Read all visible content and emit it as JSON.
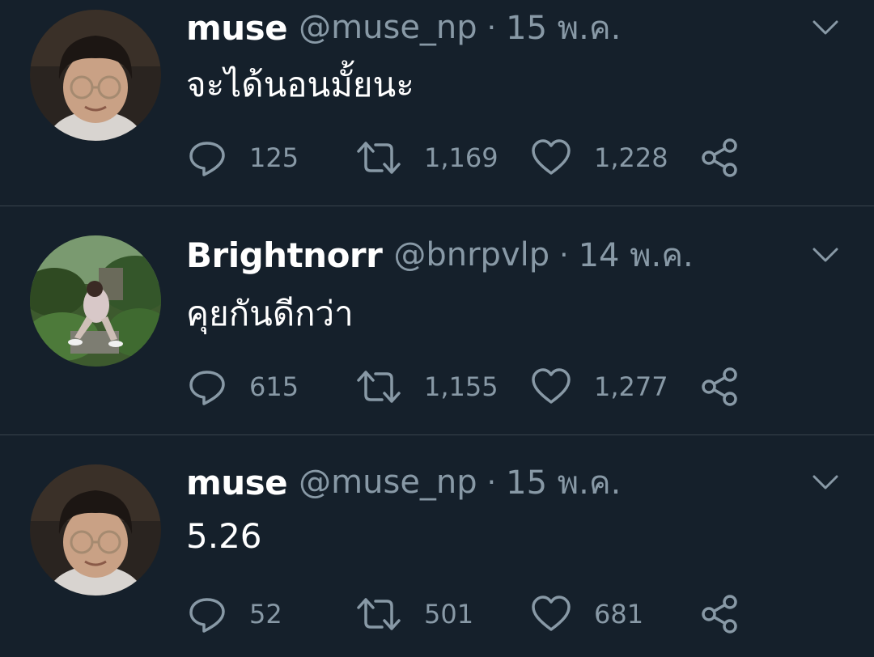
{
  "tweets": [
    {
      "name": "muse",
      "handle": "@muse_np",
      "separator": "·",
      "date": "15 พ.ค.",
      "text": "จะได้นอนมั้ยนะ",
      "replies": "125",
      "retweets": "1,169",
      "likes": "1,228"
    },
    {
      "name": "Brightnorr",
      "handle": "@bnrpvlp",
      "separator": "·",
      "date": "14 พ.ค.",
      "text": "คุยกันดีกว่า",
      "replies": "615",
      "retweets": "1,155",
      "likes": "1,277"
    },
    {
      "name": "muse",
      "handle": "@muse_np",
      "separator": "·",
      "date": "15 พ.ค.",
      "text": "5.26",
      "replies": "52",
      "retweets": "501",
      "likes": "681"
    }
  ],
  "icons": {
    "reply": "reply-icon",
    "retweet": "retweet-icon",
    "like": "heart-icon",
    "share": "share-icon",
    "more": "chevron-down-icon"
  },
  "colors": {
    "background": "#15202b",
    "divider": "#38444d",
    "secondary_text": "#8899a6",
    "primary_text": "#ffffff"
  }
}
